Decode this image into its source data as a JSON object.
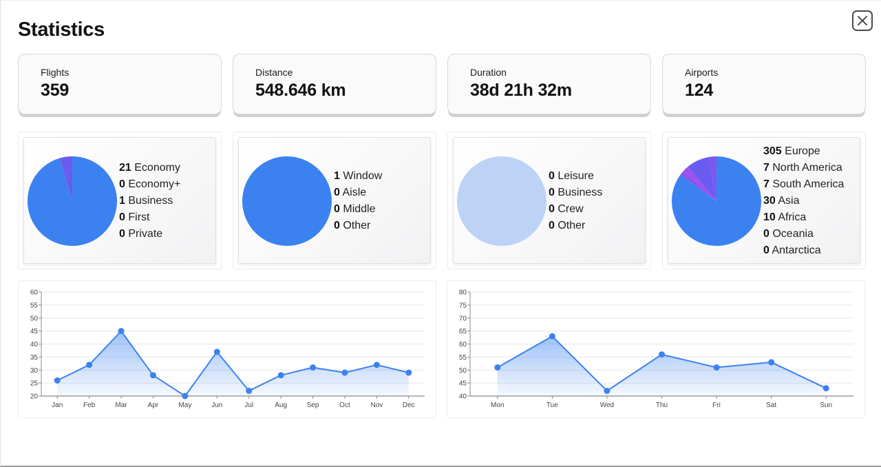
{
  "page": {
    "title": "Statistics",
    "close_label": "Close"
  },
  "stats": [
    {
      "label": "Flights",
      "value": "359"
    },
    {
      "label": "Distance",
      "value": "548.646 km"
    },
    {
      "label": "Duration",
      "value": "38d 21h 32m"
    },
    {
      "label": "Airports",
      "value": "124"
    }
  ],
  "pies": [
    {
      "id": "seat-class",
      "items": [
        {
          "count": "21",
          "label": "Economy",
          "value": 21,
          "color": "#3b82f0"
        },
        {
          "count": "0",
          "label": "Economy+",
          "value": 0,
          "color": "#5b6cf0"
        },
        {
          "count": "1",
          "label": "Business",
          "value": 1,
          "color": "#6a5cf0"
        },
        {
          "count": "0",
          "label": "First",
          "value": 0,
          "color": "#8a55f0"
        },
        {
          "count": "0",
          "label": "Private",
          "value": 0,
          "color": "#b04cf0"
        }
      ]
    },
    {
      "id": "seat-position",
      "items": [
        {
          "count": "1",
          "label": "Window",
          "value": 1,
          "color": "#3b82f0"
        },
        {
          "count": "0",
          "label": "Aisle",
          "value": 0,
          "color": "#6a5cf0"
        },
        {
          "count": "0",
          "label": "Middle",
          "value": 0,
          "color": "#8a55f0"
        },
        {
          "count": "0",
          "label": "Other",
          "value": 0,
          "color": "#b04cf0"
        }
      ]
    },
    {
      "id": "flight-reason",
      "empty_color": "#bcd3f5",
      "items": [
        {
          "count": "0",
          "label": "Leisure",
          "value": 0,
          "color": "#3b82f0"
        },
        {
          "count": "0",
          "label": "Business",
          "value": 0,
          "color": "#6a5cf0"
        },
        {
          "count": "0",
          "label": "Crew",
          "value": 0,
          "color": "#8a55f0"
        },
        {
          "count": "0",
          "label": "Other",
          "value": 0,
          "color": "#b04cf0"
        }
      ]
    },
    {
      "id": "continents",
      "items": [
        {
          "count": "305",
          "label": "Europe",
          "value": 305,
          "color": "#3b82f0"
        },
        {
          "count": "7",
          "label": "North America",
          "value": 7,
          "color": "#8a55f0"
        },
        {
          "count": "7",
          "label": "South America",
          "value": 7,
          "color": "#a34ef0"
        },
        {
          "count": "30",
          "label": "Asia",
          "value": 30,
          "color": "#6a5cf0"
        },
        {
          "count": "10",
          "label": "Africa",
          "value": 10,
          "color": "#7b58f0"
        },
        {
          "count": "0",
          "label": "Oceania",
          "value": 0,
          "color": "#c04ce8"
        },
        {
          "count": "0",
          "label": "Antarctica",
          "value": 0,
          "color": "#d946ef"
        }
      ]
    }
  ],
  "chart_data": [
    {
      "type": "area",
      "title": "",
      "xlabel": "",
      "ylabel": "",
      "categories": [
        "Jan",
        "Feb",
        "Mar",
        "Apr",
        "May",
        "Jun",
        "Jul",
        "Aug",
        "Sep",
        "Oct",
        "Nov",
        "Dec"
      ],
      "values": [
        26,
        32,
        45,
        28,
        20,
        37,
        22,
        28,
        31,
        29,
        32,
        29
      ],
      "ylim": [
        20,
        60
      ],
      "yticks": [
        20,
        25,
        30,
        35,
        40,
        45,
        50,
        55,
        60
      ],
      "grid": true,
      "color": "#3b82f0"
    },
    {
      "type": "area",
      "title": "",
      "xlabel": "",
      "ylabel": "",
      "categories": [
        "Mon",
        "Tue",
        "Wed",
        "Thu",
        "Fri",
        "Sat",
        "Sun"
      ],
      "values": [
        51,
        63,
        42,
        56,
        51,
        53,
        43
      ],
      "ylim": [
        40,
        80
      ],
      "yticks": [
        40,
        45,
        50,
        55,
        60,
        65,
        70,
        75,
        80
      ],
      "grid": true,
      "color": "#3b82f0"
    }
  ]
}
